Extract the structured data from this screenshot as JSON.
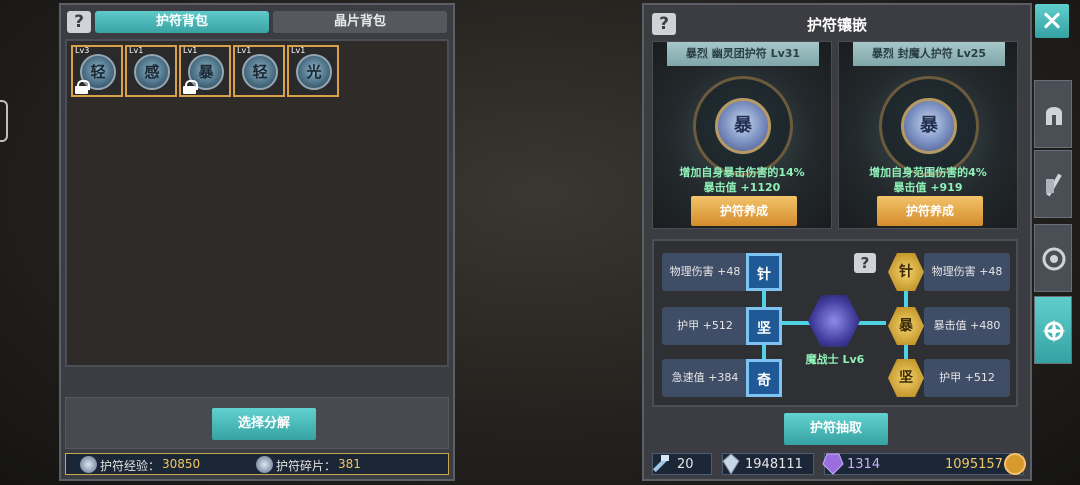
{
  "left_panel": {
    "help_icon": "?",
    "tabs": [
      "护符背包",
      "晶片背包"
    ],
    "inventory": [
      {
        "level": "Lv3",
        "char": "轻",
        "locked": true
      },
      {
        "level": "Lv1",
        "char": "感",
        "locked": false
      },
      {
        "level": "Lv1",
        "char": "暴",
        "locked": true
      },
      {
        "level": "Lv1",
        "char": "轻",
        "locked": false
      },
      {
        "level": "Lv1",
        "char": "光",
        "locked": false
      }
    ],
    "select_button": "选择分解",
    "stats": {
      "exp_label": "护符经验：",
      "exp_value": "30850",
      "shard_label": "护符碎片：",
      "shard_value": "381"
    }
  },
  "right_panel": {
    "help_icon": "?",
    "title": "护符镶嵌",
    "cards": [
      {
        "name": "暴烈 幽灵团护符 Lv31",
        "char": "暴",
        "effect1": "增加自身暴击伤害的14%",
        "effect2": "暴击值 +1120",
        "button": "护符养成"
      },
      {
        "name": "暴烈 封魔人护符 Lv25",
        "char": "暴",
        "effect1": "增加自身范围伤害的4%",
        "effect2": "暴击值 +919",
        "button": "护符养成"
      }
    ],
    "sockets": {
      "left": [
        {
          "stat": "物理伤害 +48",
          "char": "针"
        },
        {
          "stat": "护甲 +512",
          "char": "坚"
        },
        {
          "stat": "急速值 +384",
          "char": "奇"
        }
      ],
      "right": [
        {
          "stat": "物理伤害 +48",
          "char": "针"
        },
        {
          "stat": "暴击值 +480",
          "char": "暴"
        },
        {
          "stat": "护甲 +512",
          "char": "坚"
        }
      ],
      "core_label": "魔战士 Lv6",
      "help_icon": "?"
    },
    "extract_button": "护符抽取",
    "currencies": [
      "20",
      "1948111",
      "1314",
      "1095157"
    ]
  },
  "colors": {
    "teal": "#3aa3a4",
    "gold_border": "#d9a14a",
    "effect_green": "#8ff0b8",
    "value_gold": "#f1c861",
    "stat_box": "#3f4d66"
  },
  "icons": {
    "close": "close-icon",
    "side_tabs": [
      "helmet-icon",
      "glove-sword-icon",
      "target-icon",
      "compass-icon"
    ]
  }
}
